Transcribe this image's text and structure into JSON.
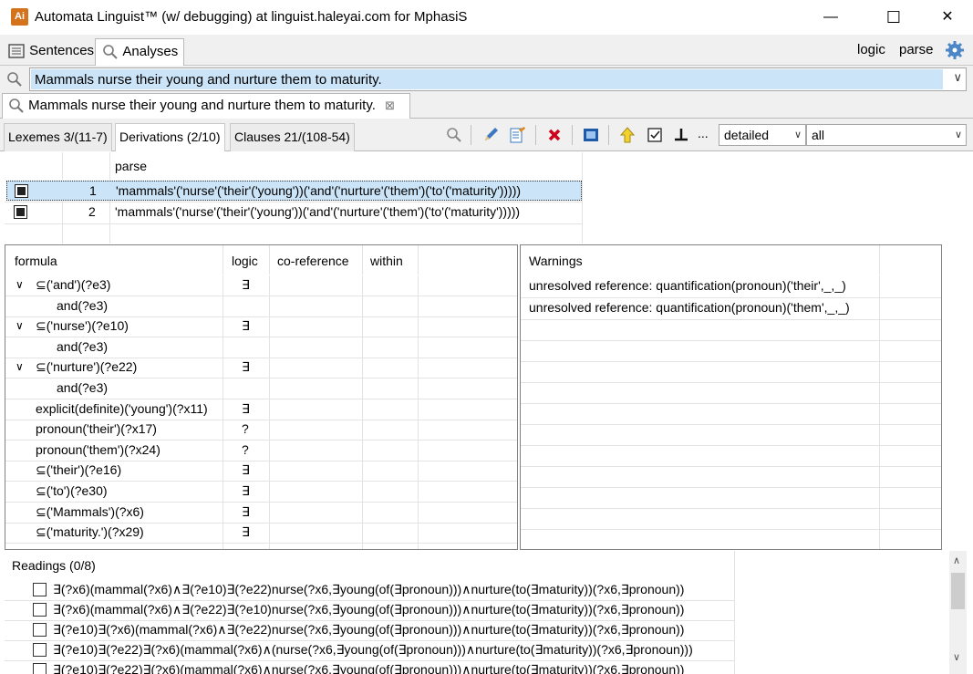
{
  "window": {
    "app_icon": "Ai",
    "title": "Automata Linguist™ (w/ debugging) at linguist.haleyai.com for MphasiS",
    "minimize": "—",
    "maximize": "☐",
    "close": "✕"
  },
  "top_tabs": [
    {
      "label": "Sentences",
      "icon": "sentences-icon",
      "active": false
    },
    {
      "label": "Analyses",
      "icon": "search-icon",
      "active": true
    }
  ],
  "top_right": {
    "logic": "logic",
    "parse": "parse",
    "settings_icon": "gear-icon"
  },
  "search": {
    "value": "Mammals nurse their young and nurture them to maturity."
  },
  "sentence_tab": {
    "label": "Mammals nurse their young and nurture them to maturity.",
    "close": "⊠"
  },
  "sub_tabs": [
    {
      "label": "Lexemes 3/(11-7)",
      "active": false
    },
    {
      "label": "Derivations (2/10)",
      "active": true
    },
    {
      "label": "Clauses 21/(108-54)",
      "active": false
    }
  ],
  "toolbar": {
    "ellipsis": "...",
    "detail_select": "detailed",
    "filter_select": "all"
  },
  "parse_table": {
    "header": "parse",
    "rows": [
      {
        "num": "1",
        "parse": "'mammals'('nurse'('their'('young'))('and'('nurture'('them')('to'('maturity')))))",
        "selected": true
      },
      {
        "num": "2",
        "parse": "'mammals'('nurse'('their'('young'))('and'('nurture'('them')('to'('maturity')))))",
        "selected": false
      }
    ]
  },
  "formula_table": {
    "headers": {
      "formula": "formula",
      "logic": "logic",
      "coref": "co-reference",
      "within": "within"
    },
    "rows": [
      {
        "formula": "⊆('and')(?e3)",
        "logic": "∃",
        "expand": "∨",
        "indent": 0
      },
      {
        "formula": "and(?e3)",
        "logic": "",
        "expand": "",
        "indent": 1
      },
      {
        "formula": "⊆('nurse')(?e10)",
        "logic": "∃",
        "expand": "∨",
        "indent": 0
      },
      {
        "formula": "and(?e3)",
        "logic": "",
        "expand": "",
        "indent": 1
      },
      {
        "formula": "⊆('nurture')(?e22)",
        "logic": "∃",
        "expand": "∨",
        "indent": 0
      },
      {
        "formula": "and(?e3)",
        "logic": "",
        "expand": "",
        "indent": 1
      },
      {
        "formula": "explicit(definite)('young')(?x11)",
        "logic": "∃",
        "expand": "",
        "indent": 0
      },
      {
        "formula": "pronoun('their')(?x17)",
        "logic": "?",
        "expand": "",
        "indent": 0
      },
      {
        "formula": "pronoun('them')(?x24)",
        "logic": "?",
        "expand": "",
        "indent": 0
      },
      {
        "formula": "⊆('their')(?e16)",
        "logic": "∃",
        "expand": "",
        "indent": 0
      },
      {
        "formula": "⊆('to')(?e30)",
        "logic": "∃",
        "expand": "",
        "indent": 0
      },
      {
        "formula": "⊆('Mammals')(?x6)",
        "logic": "∃",
        "expand": "",
        "indent": 0
      },
      {
        "formula": "⊆('maturity.')(?x29)",
        "logic": "∃",
        "expand": "",
        "indent": 0
      }
    ]
  },
  "warnings": {
    "header": "Warnings",
    "items": [
      "unresolved reference: quantification(pronoun)('their',_,_)",
      "unresolved reference: quantification(pronoun)('them',_,_)"
    ]
  },
  "readings": {
    "header": "Readings (0/8)",
    "items": [
      "∃(?x6)(mammal(?x6)∧∃(?e10)∃(?e22)nurse(?x6,∃young(of(∃pronoun)))∧nurture(to(∃maturity))(?x6,∃pronoun))",
      "∃(?x6)(mammal(?x6)∧∃(?e22)∃(?e10)nurse(?x6,∃young(of(∃pronoun)))∧nurture(to(∃maturity))(?x6,∃pronoun))",
      "∃(?e10)∃(?x6)(mammal(?x6)∧∃(?e22)nurse(?x6,∃young(of(∃pronoun)))∧nurture(to(∃maturity))(?x6,∃pronoun))",
      "∃(?e10)∃(?e22)∃(?x6)(mammal(?x6)∧(nurse(?x6,∃young(of(∃pronoun)))∧nurture(to(∃maturity))(?x6,∃pronoun)))",
      "∃(?e10)∃(?e22)∃(?x6)(mammal(?x6)∧nurse(?x6,∃young(of(∃pronoun)))∧nurture(to(∃maturity))(?x6,∃pronoun))"
    ]
  },
  "colors": {
    "selection": "#cce4f7",
    "app_icon": "#d4731b",
    "delete": "#d0021b"
  }
}
